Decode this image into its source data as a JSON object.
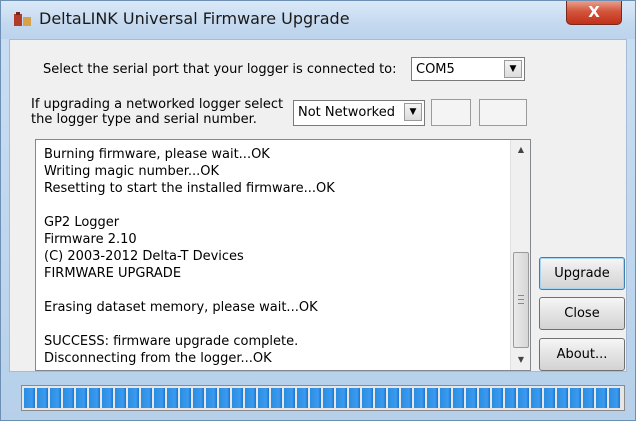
{
  "window": {
    "title": "DeltaLINK Universal Firmware Upgrade",
    "close_label": "X"
  },
  "port": {
    "label": "Select the serial port that your logger is connected to:",
    "selected": "COM5"
  },
  "network": {
    "label_line1": "If upgrading a networked logger select",
    "label_line2": "the logger type and serial number.",
    "selected": "Not Networked"
  },
  "log": {
    "lines": [
      "Burning firmware, please wait...OK",
      "Writing magic number...OK",
      "Resetting to start the installed firmware...OK",
      "",
      "GP2 Logger",
      "Firmware 2.10",
      "(C) 2003-2012 Delta-T Devices",
      "FIRMWARE UPGRADE",
      "",
      "Erasing dataset memory, please wait...OK",
      "",
      "SUCCESS: firmware upgrade complete.",
      "Disconnecting from the logger...OK"
    ]
  },
  "buttons": {
    "upgrade": "Upgrade",
    "close": "Close",
    "about": "About..."
  },
  "progress": {
    "fraction": 1.0
  },
  "icons": {
    "app": "app-icon",
    "dropdown": "chevron-down-icon",
    "scroll_up": "scroll-up-icon",
    "scroll_down": "scroll-down-icon"
  },
  "colors": {
    "progress": "#2c8de0",
    "close_button": "#c1301a"
  }
}
